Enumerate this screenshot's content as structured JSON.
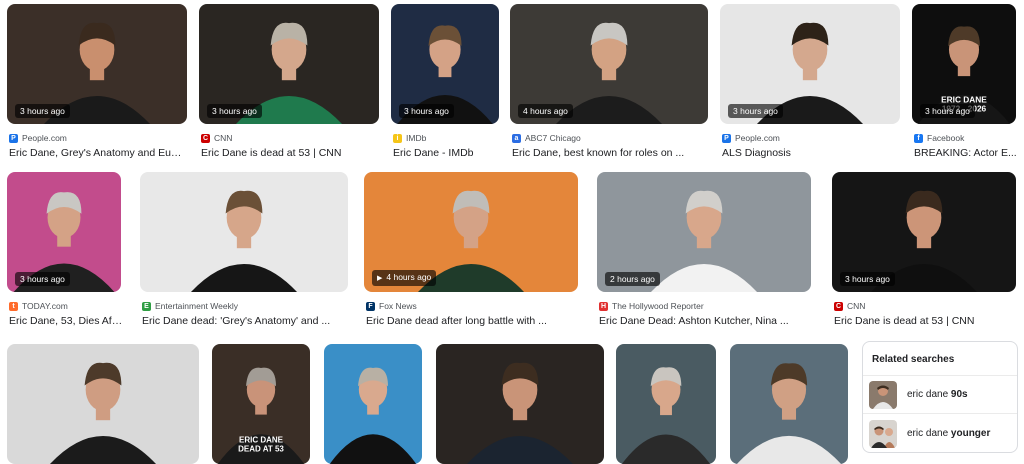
{
  "images": [
    {
      "id": "r1c1",
      "badge": "3 hours ago",
      "source": "People.com",
      "fav_color": "#1a73e8",
      "fav_glyph": "P",
      "title": "Eric Dane, Grey's Anatomy and Euph...",
      "bg": "#3b2f28",
      "suit": "#1a1a1a",
      "hair": "#3a2a1e",
      "skin": "#c98f6e"
    },
    {
      "id": "r1c2",
      "badge": "3 hours ago",
      "source": "CNN",
      "fav_color": "#cc0000",
      "fav_glyph": "C",
      "title": "Eric Dane is dead at 53 | CNN",
      "bg": "#2a2622",
      "suit": "#1f7a4d",
      "hair": "#b9b2a6",
      "skin": "#d4a78c"
    },
    {
      "id": "r1c3",
      "badge": "3 hours ago",
      "source": "IMDb",
      "fav_color": "#f5c518",
      "fav_glyph": "i",
      "title": "Eric Dane - IMDb",
      "bg": "#1f2c44",
      "suit": "#111",
      "hair": "#6b5037",
      "skin": "#d4a286"
    },
    {
      "id": "r1c4",
      "badge": "4 hours ago",
      "source": "ABC7 Chicago",
      "fav_color": "#2b6de3",
      "fav_glyph": "a",
      "title": "Eric Dane, best known for roles on ...",
      "bg": "#3d3a36",
      "suit": "#1c1c1c",
      "hair": "#c8c6c2",
      "skin": "#d3a283"
    },
    {
      "id": "r1c5",
      "badge": "3 hours ago",
      "source": "People.com",
      "fav_color": "#1a73e8",
      "fav_glyph": "P",
      "title": "ALS Diagnosis",
      "bg": "#e6e6e6",
      "suit": "#1a1a1a",
      "hair": "#2d2218",
      "skin": "#d4a88e"
    },
    {
      "id": "r1c6",
      "badge": "3 hours ago",
      "source": "Facebook",
      "fav_color": "#1877f2",
      "fav_glyph": "f",
      "title": "BREAKING: Actor E...",
      "bg": "#0e0e0e",
      "suit": "#161616",
      "hair": "#4e3a28",
      "skin": "#c99478",
      "caption1": "ERIC DANE",
      "caption2": "1972 - 2026"
    },
    {
      "id": "r2c1",
      "badge": "3 hours ago",
      "source": "TODAY.com",
      "fav_color": "#ff6b2b",
      "fav_glyph": "t",
      "title": "Eric Dane, 53, Dies Aft...",
      "bg": "#c24c8c",
      "suit": "#202020",
      "hair": "#c9c7c3",
      "skin": "#d4a286"
    },
    {
      "id": "r2c2",
      "badge": "",
      "source": "Entertainment Weekly",
      "fav_color": "#2f9e44",
      "fav_glyph": "E",
      "title": "Eric Dane dead: 'Grey's Anatomy' and ...",
      "bg": "#e8e8e8",
      "suit": "#161616",
      "hair": "#6b5037",
      "skin": "#d6a68a"
    },
    {
      "id": "r2c3",
      "badge": "4 hours ago",
      "play": true,
      "source": "Fox News",
      "fav_color": "#003366",
      "fav_glyph": "F",
      "title": "Eric Dane dead after long battle with ...",
      "bg": "#e4863a",
      "suit": "#1f3b2a",
      "hair": "#c0bdb8",
      "skin": "#d4a286"
    },
    {
      "id": "r2c4",
      "badge": "2 hours ago",
      "source": "The Hollywood Reporter",
      "fav_color": "#e03131",
      "fav_glyph": "H",
      "title": "Eric Dane Dead: Ashton Kutcher, Nina ...",
      "bg": "#8f969c",
      "suit": "#f2f2f2",
      "hair": "#d1cfcb",
      "skin": "#d8a78b"
    },
    {
      "id": "r2c5",
      "badge": "3 hours ago",
      "source": "CNN",
      "fav_color": "#cc0000",
      "fav_glyph": "C",
      "title": "Eric Dane is dead at 53 | CNN",
      "bg": "#151515",
      "suit": "#0f0f0f",
      "hair": "#3a2a1e",
      "skin": "#cc9578"
    },
    {
      "id": "r3c1",
      "badge": "",
      "source": "",
      "title": "",
      "bg": "#d9d9d9",
      "suit": "#1b1b1b",
      "hair": "#4d3a2a",
      "skin": "#cf9d82"
    },
    {
      "id": "r3c2",
      "badge": "",
      "source": "",
      "title": "",
      "bg": "#3a2e26",
      "suit": "#1a1a1a",
      "hair": "#a29c95",
      "skin": "#c99379",
      "caption1": "ERIC DANE",
      "caption2": "DEAD AT 53"
    },
    {
      "id": "r3c3",
      "badge": "",
      "source": "",
      "title": "",
      "bg": "#3a8fc7",
      "suit": "#111",
      "hair": "#b8b0a4",
      "skin": "#d9a98e"
    },
    {
      "id": "r3c4",
      "badge": "",
      "source": "",
      "title": "",
      "bg": "#2a2522",
      "suit": "#1b2430",
      "hair": "#3d2d20",
      "skin": "#c99478"
    },
    {
      "id": "r3c5",
      "badge": "",
      "source": "",
      "title": "",
      "bg": "#4a5b62",
      "suit": "#2a2a2a",
      "hair": "#c9c5bf",
      "skin": "#d8a78b"
    },
    {
      "id": "r3c6",
      "badge": "",
      "source": "",
      "title": "",
      "bg": "#5b6e7a",
      "suit": "#e8e8e8",
      "hair": "#4d3a28",
      "skin": "#d0a084"
    }
  ],
  "related": {
    "heading": "Related searches",
    "items": [
      {
        "prefix": "eric dane ",
        "bold": "90s"
      },
      {
        "prefix": "eric dane ",
        "bold": "younger"
      }
    ]
  }
}
